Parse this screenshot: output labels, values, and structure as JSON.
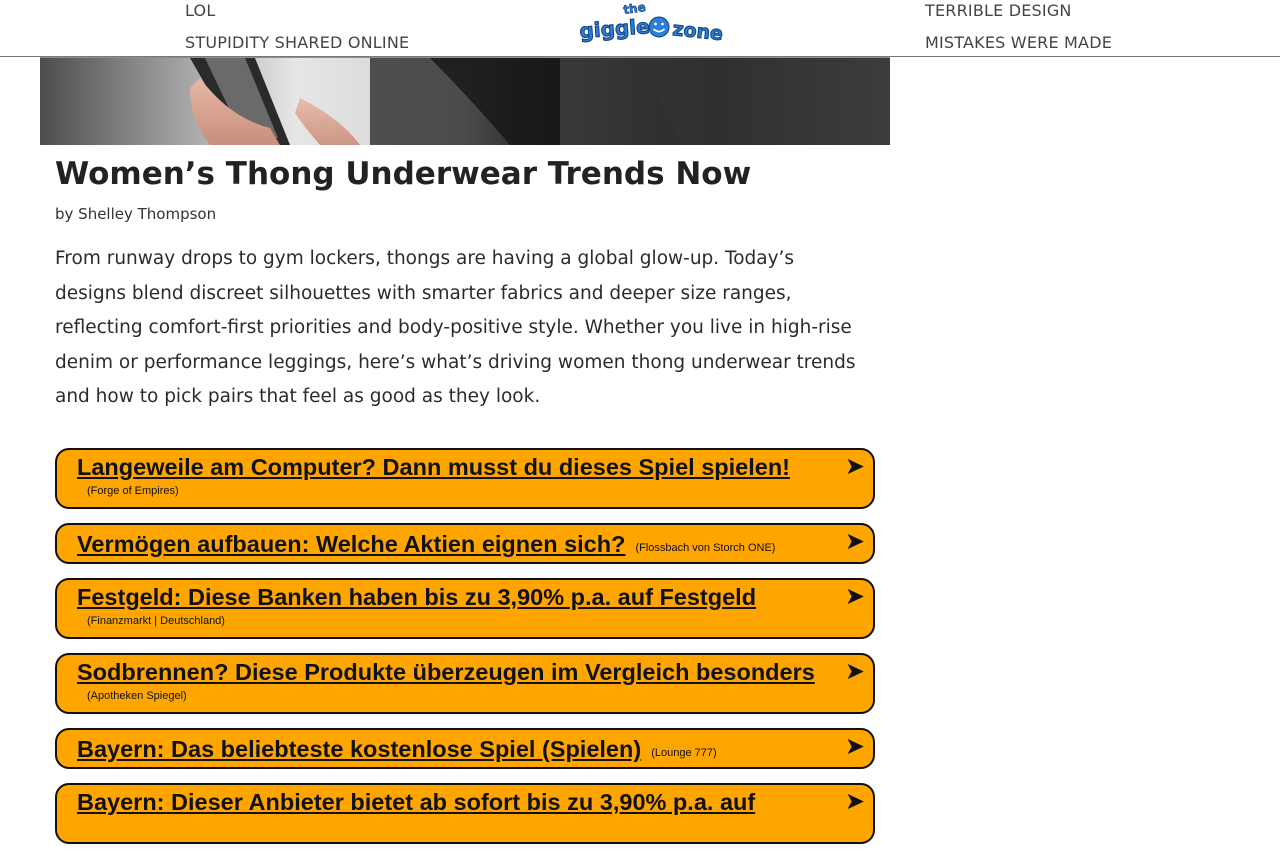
{
  "header": {
    "nav_left": [
      "LOL",
      "STUPIDITY SHARED ONLINE"
    ],
    "nav_right": [
      "TERRIBLE DESIGN",
      "MISTAKES WERE MADE"
    ],
    "logo_text": [
      "the",
      "giggle",
      "zone"
    ]
  },
  "article": {
    "title": "Women’s Thong Underwear Trends Now",
    "byline": "by Shelley Thompson",
    "intro": "From runway drops to gym lockers, thongs are having a global glow-up. Today’s designs blend discreet silhouettes with smarter fabrics and deeper size ranges, reflecting comfort-first priorities and body-positive style. Whether you live in high-rise denim or performance leggings, here’s what’s driving women thong underwear trends and how to pick pairs that feel as good as they look."
  },
  "ads": [
    {
      "title": "Langeweile am Computer? Dann musst du dieses Spiel spielen!",
      "source": "(Forge of Empires)",
      "arrow": "➤"
    },
    {
      "title": "Vermögen aufbauen: Welche Aktien eignen sich?",
      "source": "(Flossbach von Storch ONE)",
      "arrow": "➤"
    },
    {
      "title": "Festgeld: Diese Banken haben bis zu 3,90% p.a. auf Festgeld",
      "source": "(Finanzmarkt | Deutschland)",
      "arrow": "➤"
    },
    {
      "title": "Sodbrennen? Diese Produkte überzeugen im Vergleich besonders",
      "source": "(Apotheken Spiegel)",
      "arrow": "➤"
    },
    {
      "title": "Bayern: Das beliebteste kostenlose Spiel (Spielen)",
      "source": "(Lounge 777)",
      "arrow": "➤"
    },
    {
      "title": "Bayern: Dieser Anbieter bietet ab sofort bis zu 3,90% p.a. auf",
      "source": "",
      "arrow": "➤"
    }
  ],
  "colors": {
    "ad_background": "#ffa500",
    "header_accent": "#3fa9d8",
    "logo_blue": "#2b7fd6"
  }
}
